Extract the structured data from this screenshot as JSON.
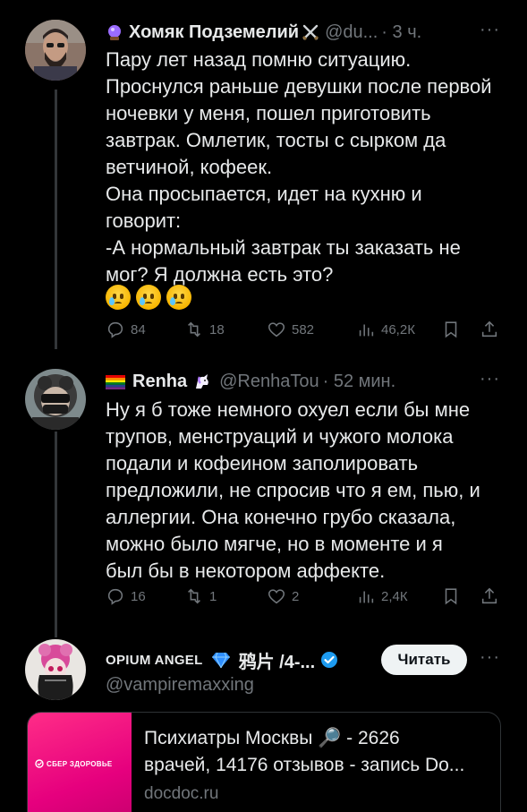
{
  "tweets": [
    {
      "author_name": "Хомяк Подземелий",
      "handle": "@du...",
      "time": "· 3 ч.",
      "more": "···",
      "lines": [
        "Пару лет назад помню ситуацию.",
        "Проснулся раньше девушки после первой",
        "ночевки у меня, пошел приготовить",
        "завтрак. Омлетик, тосты с сырком да",
        "ветчиной, кофеек.",
        "Она просыпается, идет на кухню и",
        "говорит:",
        "-А нормальный завтрак ты заказать не",
        "мог? Я должна есть это?"
      ],
      "emojis": [
        "crying-face",
        "crying-face",
        "crying-face"
      ],
      "stats": {
        "replies": "84",
        "reposts": "18",
        "likes": "582",
        "views": "46,2К"
      }
    },
    {
      "author_name": "Renha",
      "handle": "@RenhaTou",
      "time": "· 52 мин.",
      "more": "···",
      "lines": [
        "Ну я б тоже немного охуел если бы мне",
        "трупов, менструаций и чужого молока",
        "подали и кофеином заполировать",
        "предложили, не спросив что я ем, пью, и",
        "аллергии. Она конечно грубо сказала,",
        "можно было мягче, но в моменте и я",
        "был бы в некотором аффекте."
      ],
      "stats": {
        "replies": "16",
        "reposts": "1",
        "likes": "2",
        "views": "2,4К"
      }
    },
    {
      "author_name": "OPIUM ANGEL",
      "name_suffix": "鸦片 /4-...",
      "handle": "@vampiremaxxing",
      "follow_label": "Читать",
      "more": "···"
    }
  ],
  "card": {
    "image_label": "СБЕР ЗДОРОВЬЕ",
    "lines": [
      "Психиатры Москвы 🔎 - 2626",
      "врачей, 14176 отзывов - запись Do..."
    ],
    "domain": "docdoc.ru"
  },
  "colors": {
    "background": "#000000",
    "text": "#e7e9ea",
    "muted": "#71767b",
    "verified": "#1d9bf0",
    "card_brand": "#e6007e"
  }
}
